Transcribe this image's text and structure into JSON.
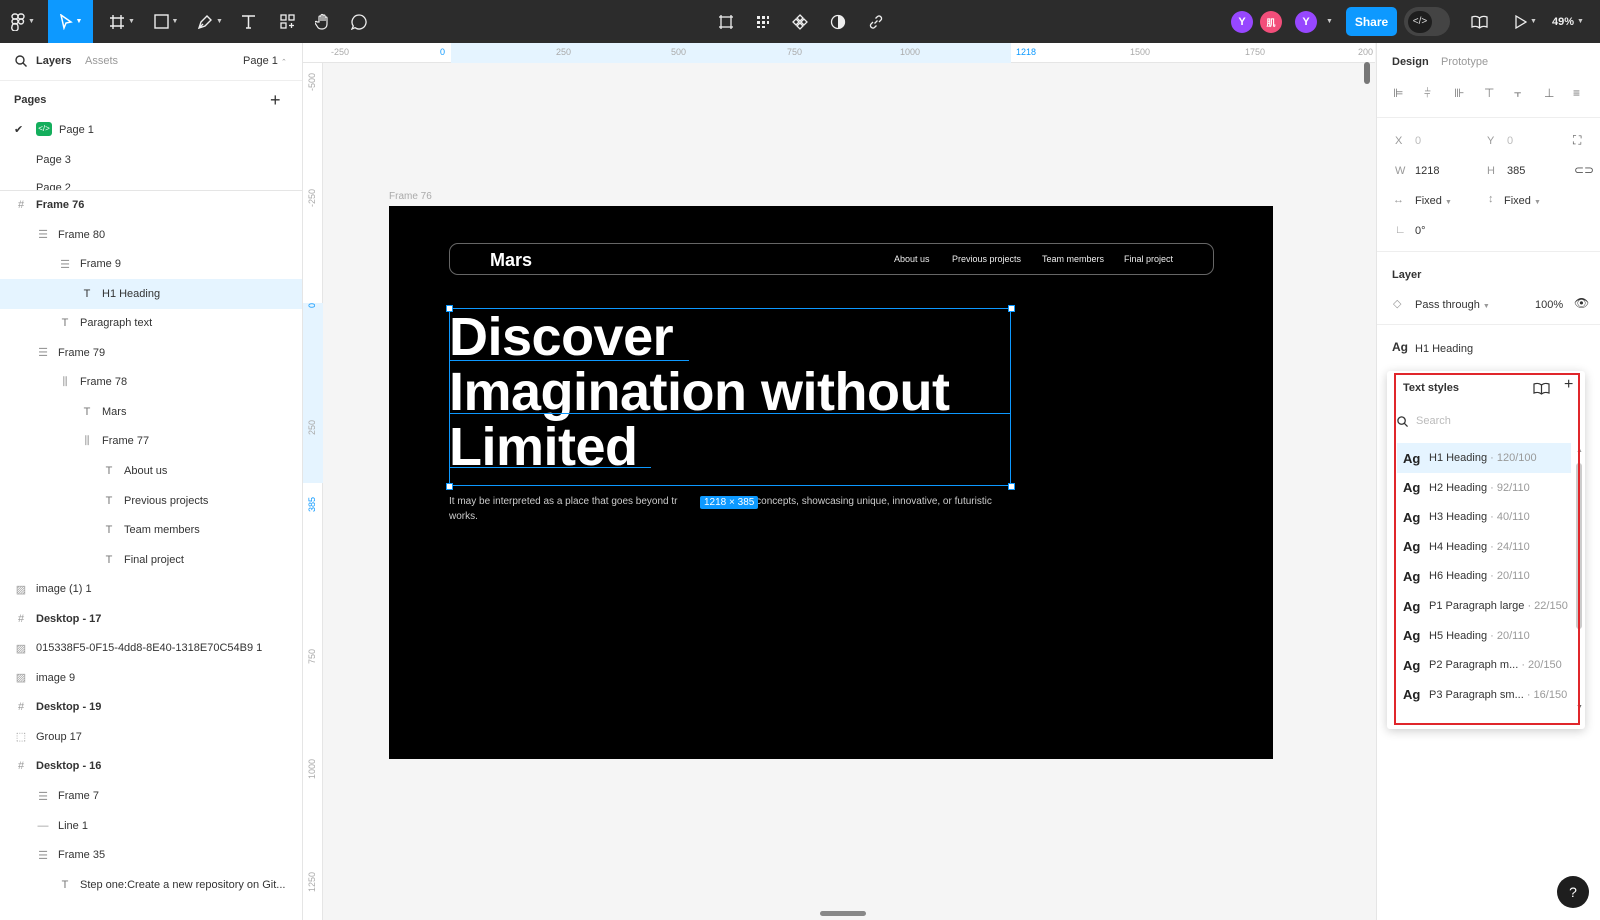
{
  "toolbar": {
    "zoom": "49%",
    "share_label": "Share",
    "avatars": [
      {
        "label": "Y",
        "color": "#9747ff"
      },
      {
        "label": "肌",
        "color": "#f24e7a"
      },
      {
        "label": "Y",
        "color": "#9747ff"
      }
    ]
  },
  "left_panel": {
    "tabs": {
      "layers": "Layers",
      "assets": "Assets",
      "page": "Page 1"
    },
    "pages_title": "Pages",
    "pages": [
      "Page 1",
      "Page 3",
      "Page 2"
    ],
    "layers": [
      {
        "name": "Frame 76",
        "type": "frame",
        "bold": true
      },
      {
        "name": "Frame 80",
        "type": "autolayout"
      },
      {
        "name": "Frame 9",
        "type": "autolayout"
      },
      {
        "name": "H1 Heading",
        "type": "text",
        "selected": true
      },
      {
        "name": "Paragraph text",
        "type": "text"
      },
      {
        "name": "Frame 79",
        "type": "autolayout"
      },
      {
        "name": "Frame 78",
        "type": "autolayout-h"
      },
      {
        "name": "Mars",
        "type": "text"
      },
      {
        "name": "Frame 77",
        "type": "autolayout-h"
      },
      {
        "name": "About us",
        "type": "text"
      },
      {
        "name": "Previous projects",
        "type": "text"
      },
      {
        "name": "Team members",
        "type": "text"
      },
      {
        "name": "Final project",
        "type": "text"
      },
      {
        "name": "image (1) 1",
        "type": "image"
      },
      {
        "name": "Desktop - 17",
        "type": "frame",
        "bold": true
      },
      {
        "name": "015338F5-0F15-4dd8-8E40-1318E70C54B9 1",
        "type": "image"
      },
      {
        "name": "image 9",
        "type": "image"
      },
      {
        "name": "Desktop - 19",
        "type": "frame",
        "bold": true
      },
      {
        "name": "Group 17",
        "type": "group"
      },
      {
        "name": "Desktop - 16",
        "type": "frame",
        "bold": true
      },
      {
        "name": "Frame 7",
        "type": "autolayout"
      },
      {
        "name": "Line 1",
        "type": "line"
      },
      {
        "name": "Frame 35",
        "type": "autolayout"
      },
      {
        "name": "Step one:Create a new repository on Git...",
        "type": "text"
      }
    ]
  },
  "rulers": {
    "top": [
      "-250",
      "0",
      "250",
      "500",
      "750",
      "1000",
      "1218",
      "1500",
      "1750",
      "200"
    ],
    "left": [
      "-500",
      "-250",
      "0",
      "250",
      "385",
      "750",
      "1000",
      "1250"
    ]
  },
  "canvas": {
    "frame_label": "Frame 76",
    "nav_logo": "Mars",
    "nav_links": [
      "About us",
      "Previous projects",
      "Team members",
      "Final project"
    ],
    "heading_lines": [
      "Discover",
      "Imagination without",
      "Limited"
    ],
    "paragraph": "It may be interpreted as a place that goes beyond tr",
    "paragraph_rest": "ery concepts, showcasing unique, innovative, or futuristic works.",
    "dimension_badge": "1218 × 385"
  },
  "right_panel": {
    "tabs": {
      "design": "Design",
      "prototype": "Prototype"
    },
    "x_label": "X",
    "x_value": "0",
    "y_label": "Y",
    "y_value": "0",
    "w_label": "W",
    "w_value": "1218",
    "h_label": "H",
    "h_value": "385",
    "width_mode": "Fixed",
    "height_mode": "Fixed",
    "rotation": "0°",
    "layer_title": "Layer",
    "blend_mode": "Pass through",
    "opacity": "100%",
    "text_style_current": "H1 Heading",
    "ag": "Ag"
  },
  "text_styles_popup": {
    "title": "Text styles",
    "search_placeholder": "Search",
    "items": [
      {
        "name": "H1 Heading",
        "meta": " · 120/100"
      },
      {
        "name": "H2 Heading",
        "meta": " · 92/110"
      },
      {
        "name": "H3 Heading",
        "meta": " · 40/110"
      },
      {
        "name": "H4 Heading",
        "meta": " · 24/110"
      },
      {
        "name": "H6 Heading",
        "meta": " · 20/110"
      },
      {
        "name": "P1 Paragraph large",
        "meta": " · 22/150"
      },
      {
        "name": "H5 Heading",
        "meta": " · 20/110"
      },
      {
        "name": "P2 Paragraph m...",
        "meta": " · 20/150"
      },
      {
        "name": "P3 Paragraph sm...",
        "meta": " · 16/150"
      }
    ]
  },
  "help_label": "?"
}
